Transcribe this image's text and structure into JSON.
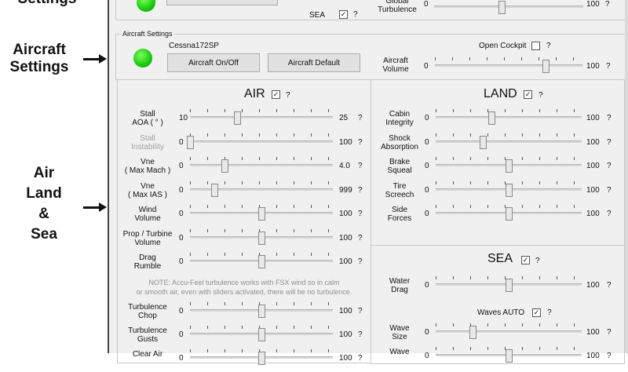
{
  "annotations": {
    "settings": "Settings",
    "aircraft_settings": "Aircraft\nSettings",
    "air_land_sea": "Air\nLand\n&\nSea"
  },
  "top": {
    "sea_label": "SEA",
    "sea_checked": true,
    "global_turbulence": "Global\nTurbulence",
    "global_min": "0",
    "global_max": "100",
    "global_value": 0.45
  },
  "aircraft": {
    "group_title": "Aircraft Settings",
    "name": "Cessna172SP",
    "onoff_button": "Aircraft On/Off",
    "default_button": "Aircraft Default",
    "open_cockpit": "Open Cockpit",
    "open_cockpit_checked": false,
    "volume_label": "Aircraft\nVolume",
    "volume_min": "0",
    "volume_max": "100",
    "volume_value": 0.75
  },
  "air": {
    "title": "AIR",
    "checked": true,
    "sliders": [
      {
        "label": "Stall\nAOA ( ° )",
        "min": "10",
        "max": "25",
        "value": 0.33,
        "disabled": false
      },
      {
        "label": "Stall\nInstability",
        "min": "0",
        "max": "100",
        "value": 0.0,
        "disabled": true
      },
      {
        "label": "Vne\n( Max Mach )",
        "min": "0",
        "max": "4.0",
        "value": 0.24,
        "disabled": false
      },
      {
        "label": "Vne\n( Max IAS )",
        "min": "0",
        "max": "999",
        "value": 0.17,
        "disabled": false
      },
      {
        "label": "Wind\nVolume",
        "min": "0",
        "max": "100",
        "value": 0.5,
        "disabled": false
      },
      {
        "label": "Prop / Turbine\nVolume",
        "min": "0",
        "max": "100",
        "value": 0.5,
        "disabled": false
      },
      {
        "label": "Drag\nRumble",
        "min": "0",
        "max": "100",
        "value": 0.5,
        "disabled": false
      }
    ],
    "note": "NOTE:  Accu-Feel turbulence works with FSX wind so in calm\nor smooth air, even with sliders activated, there will be no turbulence.",
    "turb_sliders": [
      {
        "label": "Turbulence\nChop",
        "min": "0",
        "max": "100",
        "value": 0.5
      },
      {
        "label": "Turbulence\nGusts",
        "min": "0",
        "max": "100",
        "value": 0.5
      },
      {
        "label": "Clear Air",
        "min": "0",
        "max": "100",
        "value": 0.5
      }
    ]
  },
  "land": {
    "title": "LAND",
    "checked": true,
    "sliders": [
      {
        "label": "Cabin\nIntegrity",
        "min": "0",
        "max": "100",
        "value": 0.38
      },
      {
        "label": "Shock\nAbsorption",
        "min": "0",
        "max": "100",
        "value": 0.32
      },
      {
        "label": "Brake\nSqueal",
        "min": "0",
        "max": "100",
        "value": 0.5
      },
      {
        "label": "Tire\nScreech",
        "min": "0",
        "max": "100",
        "value": 0.5
      },
      {
        "label": "Side\nForces",
        "min": "0",
        "max": "100",
        "value": 0.5
      }
    ]
  },
  "sea": {
    "title": "SEA",
    "checked": true,
    "water_drag": {
      "label": "Water\nDrag",
      "min": "0",
      "max": "100",
      "value": 0.5
    },
    "waves_auto": "Waves AUTO",
    "waves_checked": true,
    "wave_size": {
      "label": "Wave\nSize",
      "min": "0",
      "max": "100",
      "value": 0.25
    },
    "wave_next": {
      "label": "Wave",
      "min": "0",
      "max": "100",
      "value": 0.5
    }
  },
  "help_mark": "?"
}
